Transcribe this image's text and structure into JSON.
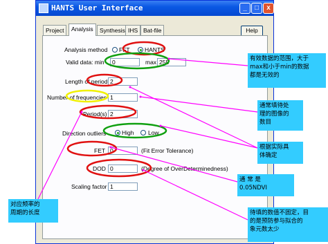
{
  "window": {
    "title": "HANTS User Interface",
    "controls": {
      "minimize": "_",
      "maximize": "□",
      "close": "x"
    }
  },
  "tabs": [
    {
      "label": "Project",
      "active": false
    },
    {
      "label": "Analysis",
      "active": true
    },
    {
      "label": "Synthesis",
      "active": false
    },
    {
      "label": "IHS",
      "active": false
    },
    {
      "label": "Bat-file",
      "active": false
    }
  ],
  "help_label": "Help",
  "form": {
    "analysis_method": {
      "label": "Analysis method",
      "option_fft": "FFT",
      "option_hants": "HANTS",
      "selected": "HANTS"
    },
    "valid_data": {
      "label": "Valid data: min",
      "min_value": "0",
      "max_label": "max",
      "max_value": "255"
    },
    "length_of_period": {
      "label": "Length of period",
      "value": "2"
    },
    "number_of_frequencies": {
      "label": "Number of frequencies",
      "value": "1"
    },
    "periods": {
      "label": "Period(s)",
      "value": "2"
    },
    "direction_outliers": {
      "label": "Direction outliers",
      "option_high": "High",
      "option_low": "Low",
      "selected": "High"
    },
    "fet": {
      "label": "FET",
      "value": "0",
      "hint": "(Fit Error Tolerance)"
    },
    "dod": {
      "label": "DOD",
      "value": "0",
      "hint": "(Degree of OverDeterminedness)"
    },
    "scaling_factor": {
      "label": "Scaling factor",
      "value": "1"
    }
  },
  "annotations": {
    "valid_range": [
      "有效数据的范围，大于",
      "max和小于min的数据",
      "都是无效的"
    ],
    "number_of_images": [
      "通常填待处",
      "理的图像的",
      "数目"
    ],
    "fet_note": [
      "根据实际具",
      "体确定"
    ],
    "usually_ndvi": [
      "通   常   是",
      "0.05NDVI"
    ],
    "dod_note": [
      "待填的数值不固定，目",
      "的是预防参与拟合的",
      "象元数太少"
    ],
    "period_note": [
      "对应频率的",
      "周期的长度"
    ]
  },
  "colors": {
    "note_background": "#33ccff",
    "highlight_red": "#e01010",
    "highlight_green": "#10a010",
    "highlight_yellow": "#f0f000",
    "pointer_magenta": "#ff00ff"
  }
}
